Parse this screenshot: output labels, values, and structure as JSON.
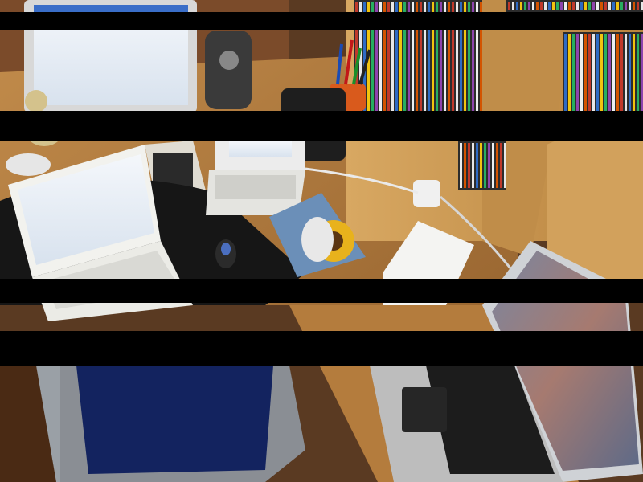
{
  "photo": {
    "subject": "desk-with-computers",
    "obstruction": "horizontal-black-bars",
    "palette": {
      "desk_wood": "#b07a3e",
      "shelf_wood": "#c99a55",
      "floor": "#6b3f22",
      "mousepad": "#161616",
      "chair_seat": "#13235f",
      "laptop_white": "#eeeeea",
      "screen_glow": "#e8eef6",
      "bars": "#000000"
    }
  }
}
